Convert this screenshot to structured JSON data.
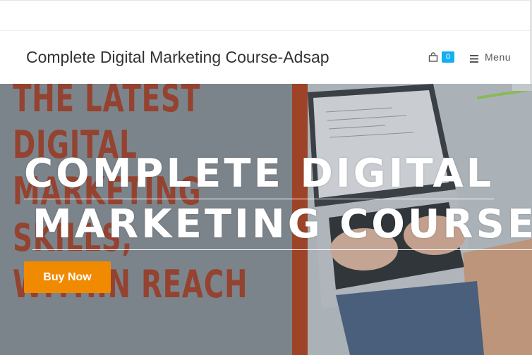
{
  "header": {
    "site_title": "Complete Digital Marketing Course-Adsap",
    "cart_count": "0",
    "menu_label": "Menu"
  },
  "hero": {
    "poster_lines": [
      "THE LATEST",
      "DIGITAL",
      "MARKETING",
      "SKILLS,",
      "WITHIN REACH"
    ],
    "headline_line1": "COMPLETE DIGITAL",
    "headline_line2": "MARKETING COURSE",
    "button_label": "Buy Now"
  },
  "colors": {
    "accent": "#13aff0",
    "button": "#f08a00",
    "poster_text": "#a8432a"
  },
  "icons": [
    "shopping-bag-icon",
    "hamburger-menu-icon"
  ]
}
